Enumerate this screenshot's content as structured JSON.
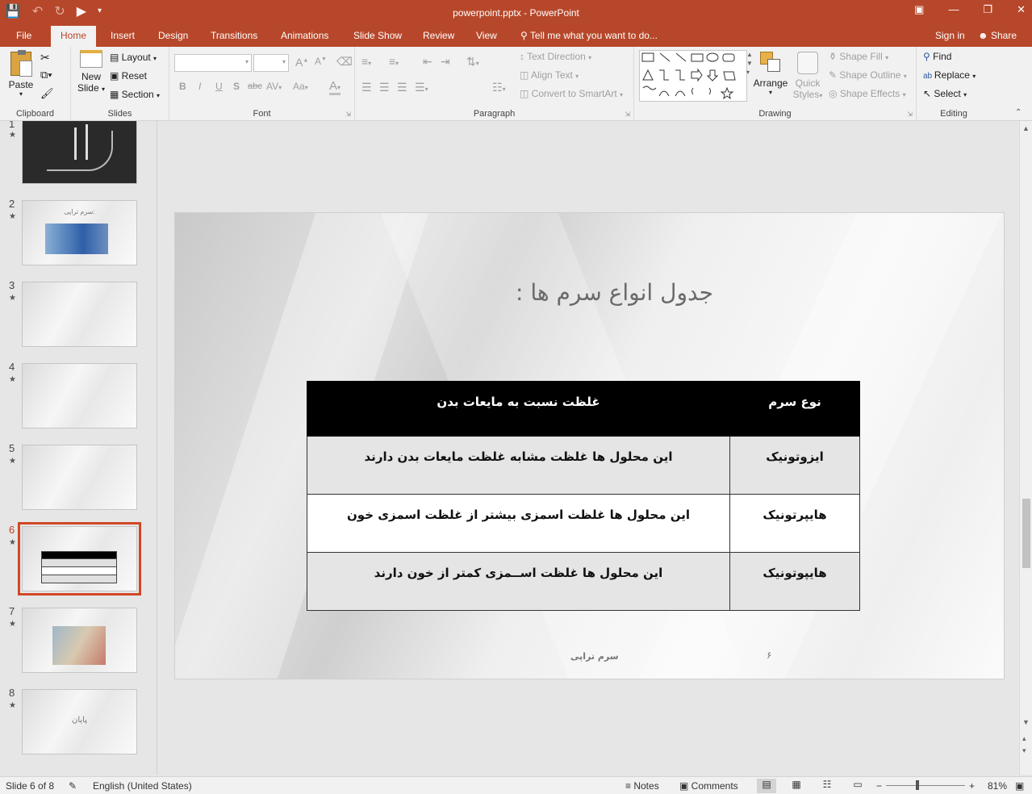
{
  "app": {
    "window_title": "powerpoint.pptx - PowerPoint"
  },
  "tabs": [
    {
      "label": "File"
    },
    {
      "label": "Home"
    },
    {
      "label": "Insert"
    },
    {
      "label": "Design"
    },
    {
      "label": "Transitions"
    },
    {
      "label": "Animations"
    },
    {
      "label": "Slide Show"
    },
    {
      "label": "Review"
    },
    {
      "label": "View"
    }
  ],
  "tell_me": "Tell me what you want to do...",
  "sign_in": "Sign in",
  "share": "Share",
  "ribbon": {
    "clipboard": {
      "label": "Clipboard",
      "paste": "Paste"
    },
    "slides": {
      "label": "Slides",
      "new_slide_line1": "New",
      "new_slide_line2": "Slide",
      "layout": "Layout",
      "reset": "Reset",
      "section": "Section"
    },
    "font": {
      "label": "Font",
      "bold": "B",
      "italic": "I",
      "underline": "U",
      "shadow": "S",
      "strike": "abc",
      "spacing": "AV",
      "case": "Aa",
      "color": "A"
    },
    "paragraph": {
      "label": "Paragraph",
      "text_direction": "Text Direction",
      "align_text": "Align Text",
      "smartart": "Convert to SmartArt"
    },
    "drawing": {
      "label": "Drawing",
      "arrange": "Arrange",
      "quick_styles_line1": "Quick",
      "quick_styles_line2": "Styles",
      "shape_fill": "Shape Fill",
      "shape_outline": "Shape Outline",
      "shape_effects": "Shape Effects"
    },
    "editing": {
      "label": "Editing",
      "find": "Find",
      "replace": "Replace",
      "select": "Select"
    }
  },
  "thumbnails": [
    {
      "num": "1"
    },
    {
      "num": "2",
      "title": "سرم تراپی:"
    },
    {
      "num": "3"
    },
    {
      "num": "4"
    },
    {
      "num": "5"
    },
    {
      "num": "6"
    },
    {
      "num": "7"
    },
    {
      "num": "8",
      "title": "پایان"
    }
  ],
  "slide": {
    "title": "جدول انواع سرم ها :",
    "table": {
      "headers": [
        "نوع سرم",
        "غلظت نسبت به مایعات بدن"
      ],
      "rows": [
        [
          "ایزوتونیک",
          "این محلول ها غلظت مشابه غلظت مایعات بدن دارند"
        ],
        [
          "هایپرتونیک",
          "این محلول ها غلظت اسمزی بیشتر از غلظت اسمزی خون"
        ],
        [
          "هایپوتونیک",
          "این محلول ها غلظت اســمزی کمتر از خون دارند"
        ]
      ]
    },
    "footer": "سرم تراپی",
    "number": "۶"
  },
  "status": {
    "slide_of": "Slide 6 of 8",
    "language": "English (United States)",
    "notes": "Notes",
    "comments": "Comments",
    "zoom": "81%"
  },
  "colors": {
    "accent": "#b7472a",
    "ribbon_bg": "#f1f1f1",
    "active_thumb": "#d24726"
  }
}
